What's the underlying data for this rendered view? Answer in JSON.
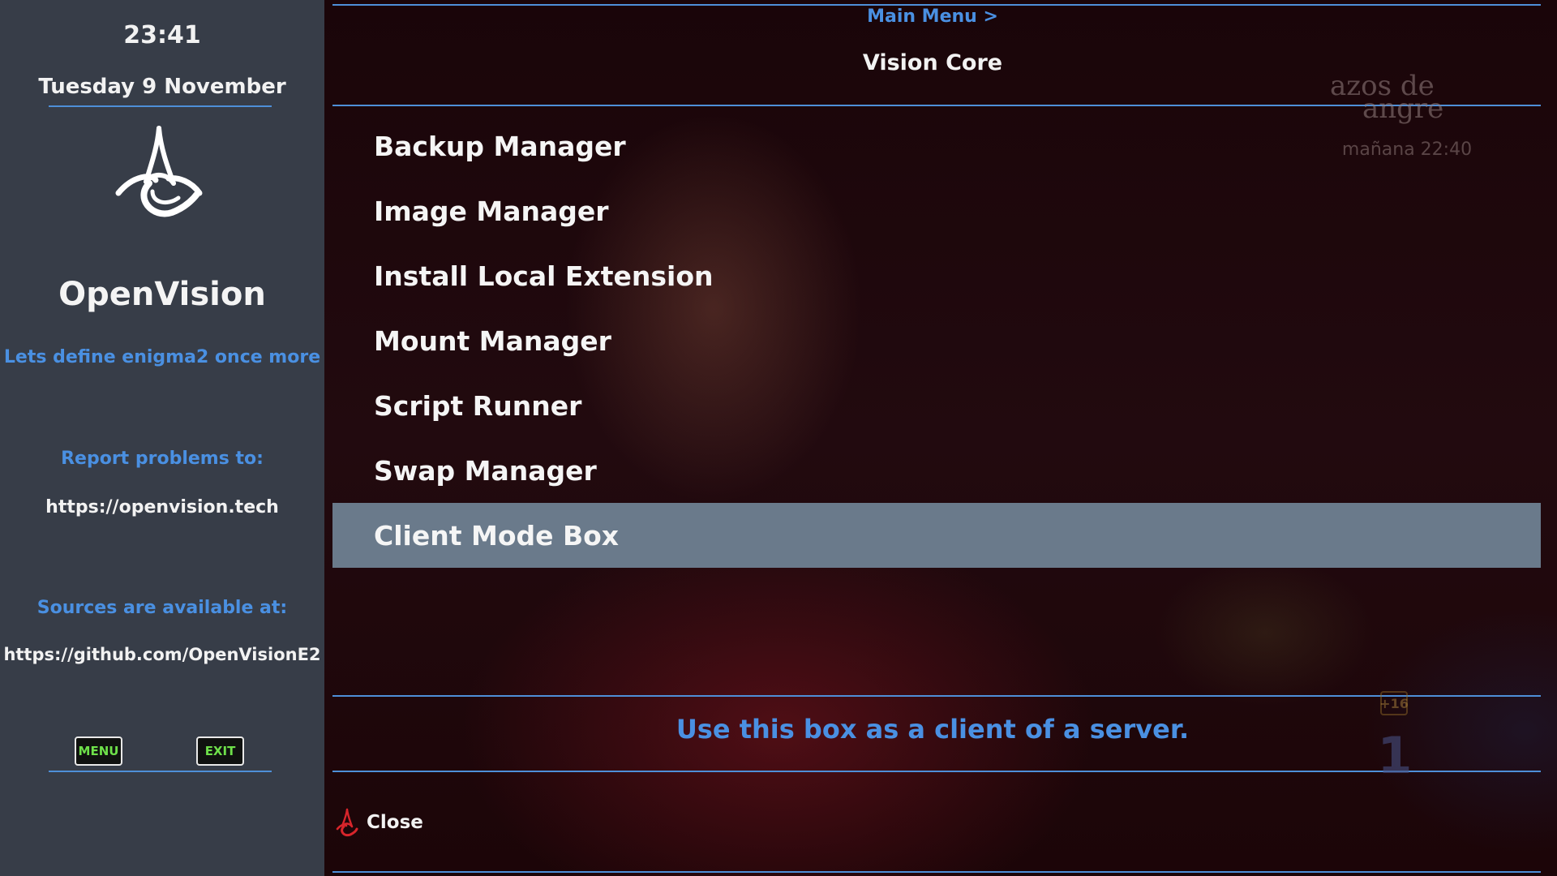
{
  "sidebar": {
    "clock": "23:41",
    "date": "Tuesday 9 November",
    "logo_icon": "openvision-logo",
    "brand": "OpenVision",
    "tagline": "Lets define enigma2 once more",
    "report_label": "Report problems to:",
    "report_url": "https://openvision.tech",
    "sources_label": "Sources are available at:",
    "sources_url": "https://github.com/OpenVisionE2",
    "keys": {
      "menu_label": "MENU",
      "exit_label": "EXIT"
    }
  },
  "header": {
    "breadcrumb": "Main Menu >",
    "title": "Vision Core"
  },
  "background_overlay": {
    "watermark_line1": "azos de",
    "watermark_line2": "angre",
    "next_show": "mañana 22:40",
    "age_rating": "+16",
    "channel_number": "1"
  },
  "menu": {
    "items": [
      {
        "label": "Backup Manager"
      },
      {
        "label": "Image Manager"
      },
      {
        "label": "Install Local Extension"
      },
      {
        "label": "Mount Manager"
      },
      {
        "label": "Script Runner"
      },
      {
        "label": "Swap Manager"
      },
      {
        "label": "Client Mode Box",
        "selected": true
      }
    ]
  },
  "description": "Use this box as a client of a server.",
  "footer": {
    "close_label": "Close",
    "close_icon": "red-openvision-logo"
  },
  "colors": {
    "accent": "#4a90e2",
    "sidebar_bg": "#373d48",
    "selection_bg": "#6a7a8b",
    "key_text": "#6ee04a",
    "close_icon": "#d8252b"
  }
}
